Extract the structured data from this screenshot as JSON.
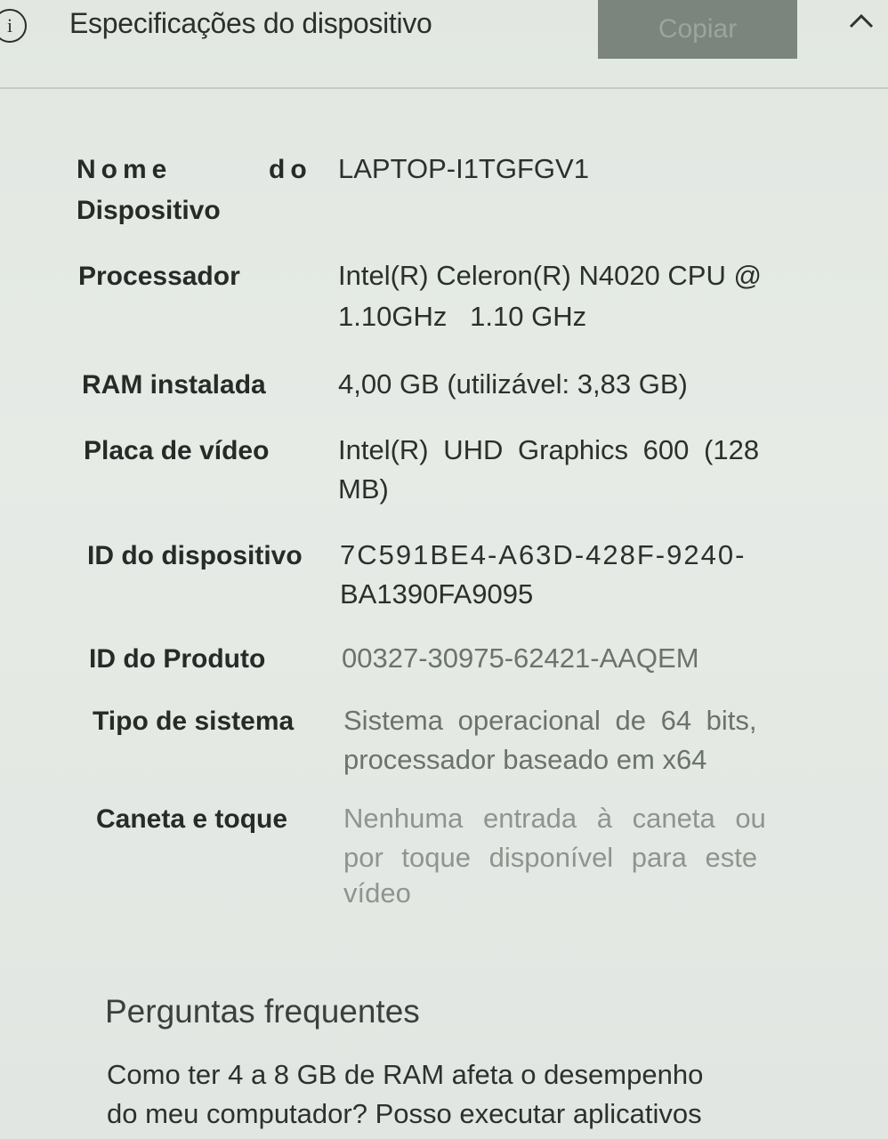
{
  "header": {
    "title": "Especificações do dispositivo",
    "copy_label": "Copiar",
    "icons": {
      "info": "info-icon",
      "collapse": "chevron-up-icon"
    }
  },
  "specs": [
    {
      "label_part1": "Nome",
      "label_part2": "do",
      "label_part3": "Dispositivo",
      "value": "LAPTOP-I1TGFGV1"
    },
    {
      "label": "Processador",
      "value_line1": "Intel(R) Celeron(R) N4020 CPU @",
      "value_line2": "1.10GHz   1.10 GHz"
    },
    {
      "label": "RAM instalada",
      "value": "4,00 GB (utilizável: 3,83 GB)"
    },
    {
      "label": "Placa de vídeo",
      "value_line1": "Intel(R) UHD Graphics 600 (128",
      "value_line2": "MB)"
    },
    {
      "label": "ID do dispositivo",
      "value_line1": "7C591BE4-A63D-428F-9240-",
      "value_line2": "BA1390FA9095"
    },
    {
      "label": "ID do Produto",
      "value": "00327-30975-62421-AAQEM"
    },
    {
      "label": "Tipo de sistema",
      "value_line1": "Sistema operacional de 64 bits,",
      "value_line2": "processador baseado em x64"
    },
    {
      "label": "Caneta e toque",
      "value_line1": "Nenhuma entrada à caneta ou",
      "value_line2": "por toque disponível para este",
      "value_line3": "vídeo"
    }
  ],
  "faq": {
    "title": "Perguntas frequentes",
    "link_line1": "Como ter 4 a 8 GB de RAM afeta o desempenho",
    "link_line2": "do meu computador? Posso executar aplicativos"
  }
}
